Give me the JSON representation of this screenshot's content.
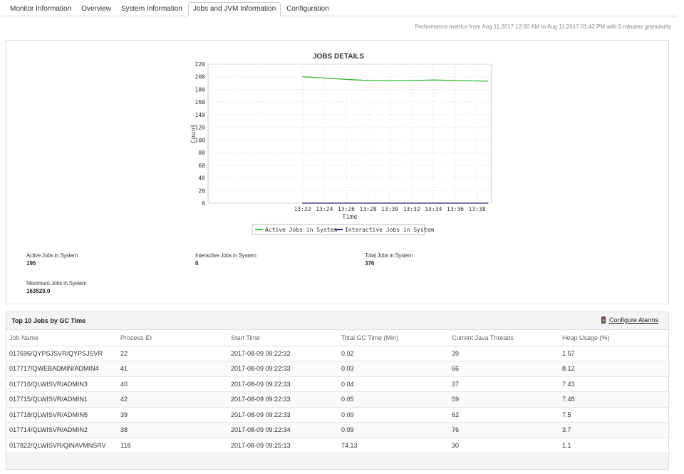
{
  "tabs": [
    {
      "label": "Monitor Information",
      "active": false
    },
    {
      "label": "Overview",
      "active": false
    },
    {
      "label": "System Information",
      "active": false
    },
    {
      "label": "Jobs and JVM Information",
      "active": true
    },
    {
      "label": "Configuration",
      "active": false
    }
  ],
  "performance_text": "Performance metrics from Aug 11,2017 12:00 AM to Aug 11,2017 01:42 PM with 5 minutes granularity",
  "chart_data": {
    "type": "line",
    "title": "JOBS DETAILS",
    "xlabel": "Time",
    "ylabel": "Count",
    "x_ticks": [
      "13:22",
      "13:24",
      "13:26",
      "13:28",
      "13:30",
      "13:32",
      "13:34",
      "13:36",
      "13:38"
    ],
    "x_range_minutes": [
      13.333,
      39.333
    ],
    "ylim": [
      0,
      220
    ],
    "y_ticks": [
      0,
      20,
      40,
      60,
      80,
      100,
      120,
      140,
      160,
      180,
      200,
      220
    ],
    "grid": true,
    "legend_position": "bottom",
    "series": [
      {
        "name": "Active Jobs in System",
        "color": "#33bb33",
        "x": [
          "13:22",
          "13:24",
          "13:26",
          "13:28",
          "13:30",
          "13:32",
          "13:34",
          "13:36",
          "13:39"
        ],
        "values": [
          200,
          198,
          196,
          194,
          194,
          194,
          195,
          194,
          193
        ]
      },
      {
        "name": "Interactive Jobs in System",
        "color": "#332288",
        "x": [
          "13:22",
          "13:24",
          "13:26",
          "13:28",
          "13:30",
          "13:32",
          "13:34",
          "13:36",
          "13:39"
        ],
        "values": [
          0,
          0,
          0,
          0,
          0,
          0,
          0,
          0,
          0
        ]
      }
    ]
  },
  "stats": {
    "active_label": "Active Jobs in System",
    "active_value": "195",
    "interactive_label": "Interactive Jobs in System",
    "interactive_value": "0",
    "total_label": "Total Jobs in System",
    "total_value": "376",
    "max_label": "Maximum Jobs in System",
    "max_value": "163520.0"
  },
  "gc_table": {
    "title": "Top 10 Jobs by GC Time",
    "alarm_link": "Configure Alarms",
    "alarm_icon": "traffic-light-icon",
    "columns": [
      "Job Name",
      "Process ID",
      "Start Time",
      "Total GC Time  (Min)",
      "Current Java Threads",
      "Heap Usage  (%)"
    ],
    "rows": [
      [
        "017696/QYPSJSVR/QYPSJSVR",
        "22",
        "2017-08-09 09:22:32",
        "0.02",
        "39",
        "1.57"
      ],
      [
        "017717/QWEBADMIN/ADMIN4",
        "41",
        "2017-08-09 09:22:33",
        "0.03",
        "66",
        "8.12"
      ],
      [
        "017716/QLWISVR/ADMIN3",
        "40",
        "2017-08-09 09:22:33",
        "0.04",
        "37",
        "7.43"
      ],
      [
        "017715/QLWISVR/ADMIN1",
        "42",
        "2017-08-09 09:22:33",
        "0.05",
        "59",
        "7.48"
      ],
      [
        "017718/QLWISVR/ADMIN5",
        "39",
        "2017-08-09 09:22:33",
        "0.09",
        "62",
        "7.5"
      ],
      [
        "017714/QLWISVR/ADMIN2",
        "38",
        "2017-08-09 09:22:34",
        "0.09",
        "76",
        "3.7"
      ],
      [
        "017822/QLWISVR/QINAVMNSRV",
        "118",
        "2017-08-09 09:25:13",
        "74.13",
        "30",
        "1.1"
      ]
    ]
  }
}
